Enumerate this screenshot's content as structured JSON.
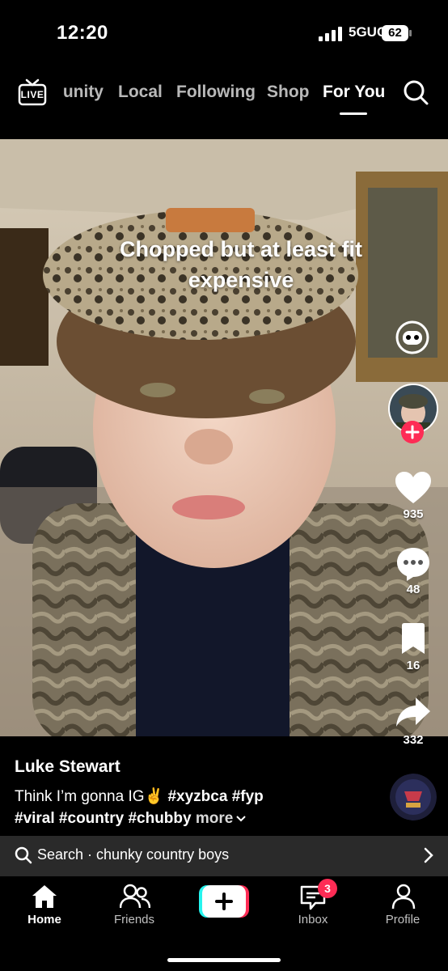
{
  "status_bar": {
    "time": "12:20",
    "network": "5GUC",
    "battery": "62"
  },
  "top_nav": {
    "live_label": "LIVE",
    "tabs": [
      "unity",
      "Local",
      "Following",
      "Shop",
      "For You"
    ],
    "active_tab": "For You"
  },
  "video": {
    "caption_overlay": "Chopped but at least fit expensive",
    "actions": {
      "likes": "935",
      "comments": "48",
      "bookmarks": "16",
      "shares": "332"
    }
  },
  "post": {
    "author": "Luke Stewart",
    "description_text": "Think I’m gonna IG✌️",
    "hashtags_line1": "#xyzbca #fyp",
    "hashtags_line2": "#viral #country #chubby",
    "more_label": "more"
  },
  "search_bar": {
    "text": "Search · chunky country boys"
  },
  "bottom_nav": {
    "items": [
      "Home",
      "Friends",
      "",
      "Inbox",
      "Profile"
    ],
    "active": "Home",
    "inbox_badge": "3"
  },
  "colors": {
    "accent_red": "#fe2c55",
    "accent_cyan": "#25f4ee",
    "background": "#000000"
  },
  "icons": [
    "live-icon",
    "search-icon",
    "sticker-icon",
    "heart-icon",
    "comment-icon",
    "bookmark-icon",
    "share-icon",
    "home-icon",
    "friends-icon",
    "plus-icon",
    "inbox-icon",
    "profile-icon",
    "chevron-right-icon"
  ]
}
